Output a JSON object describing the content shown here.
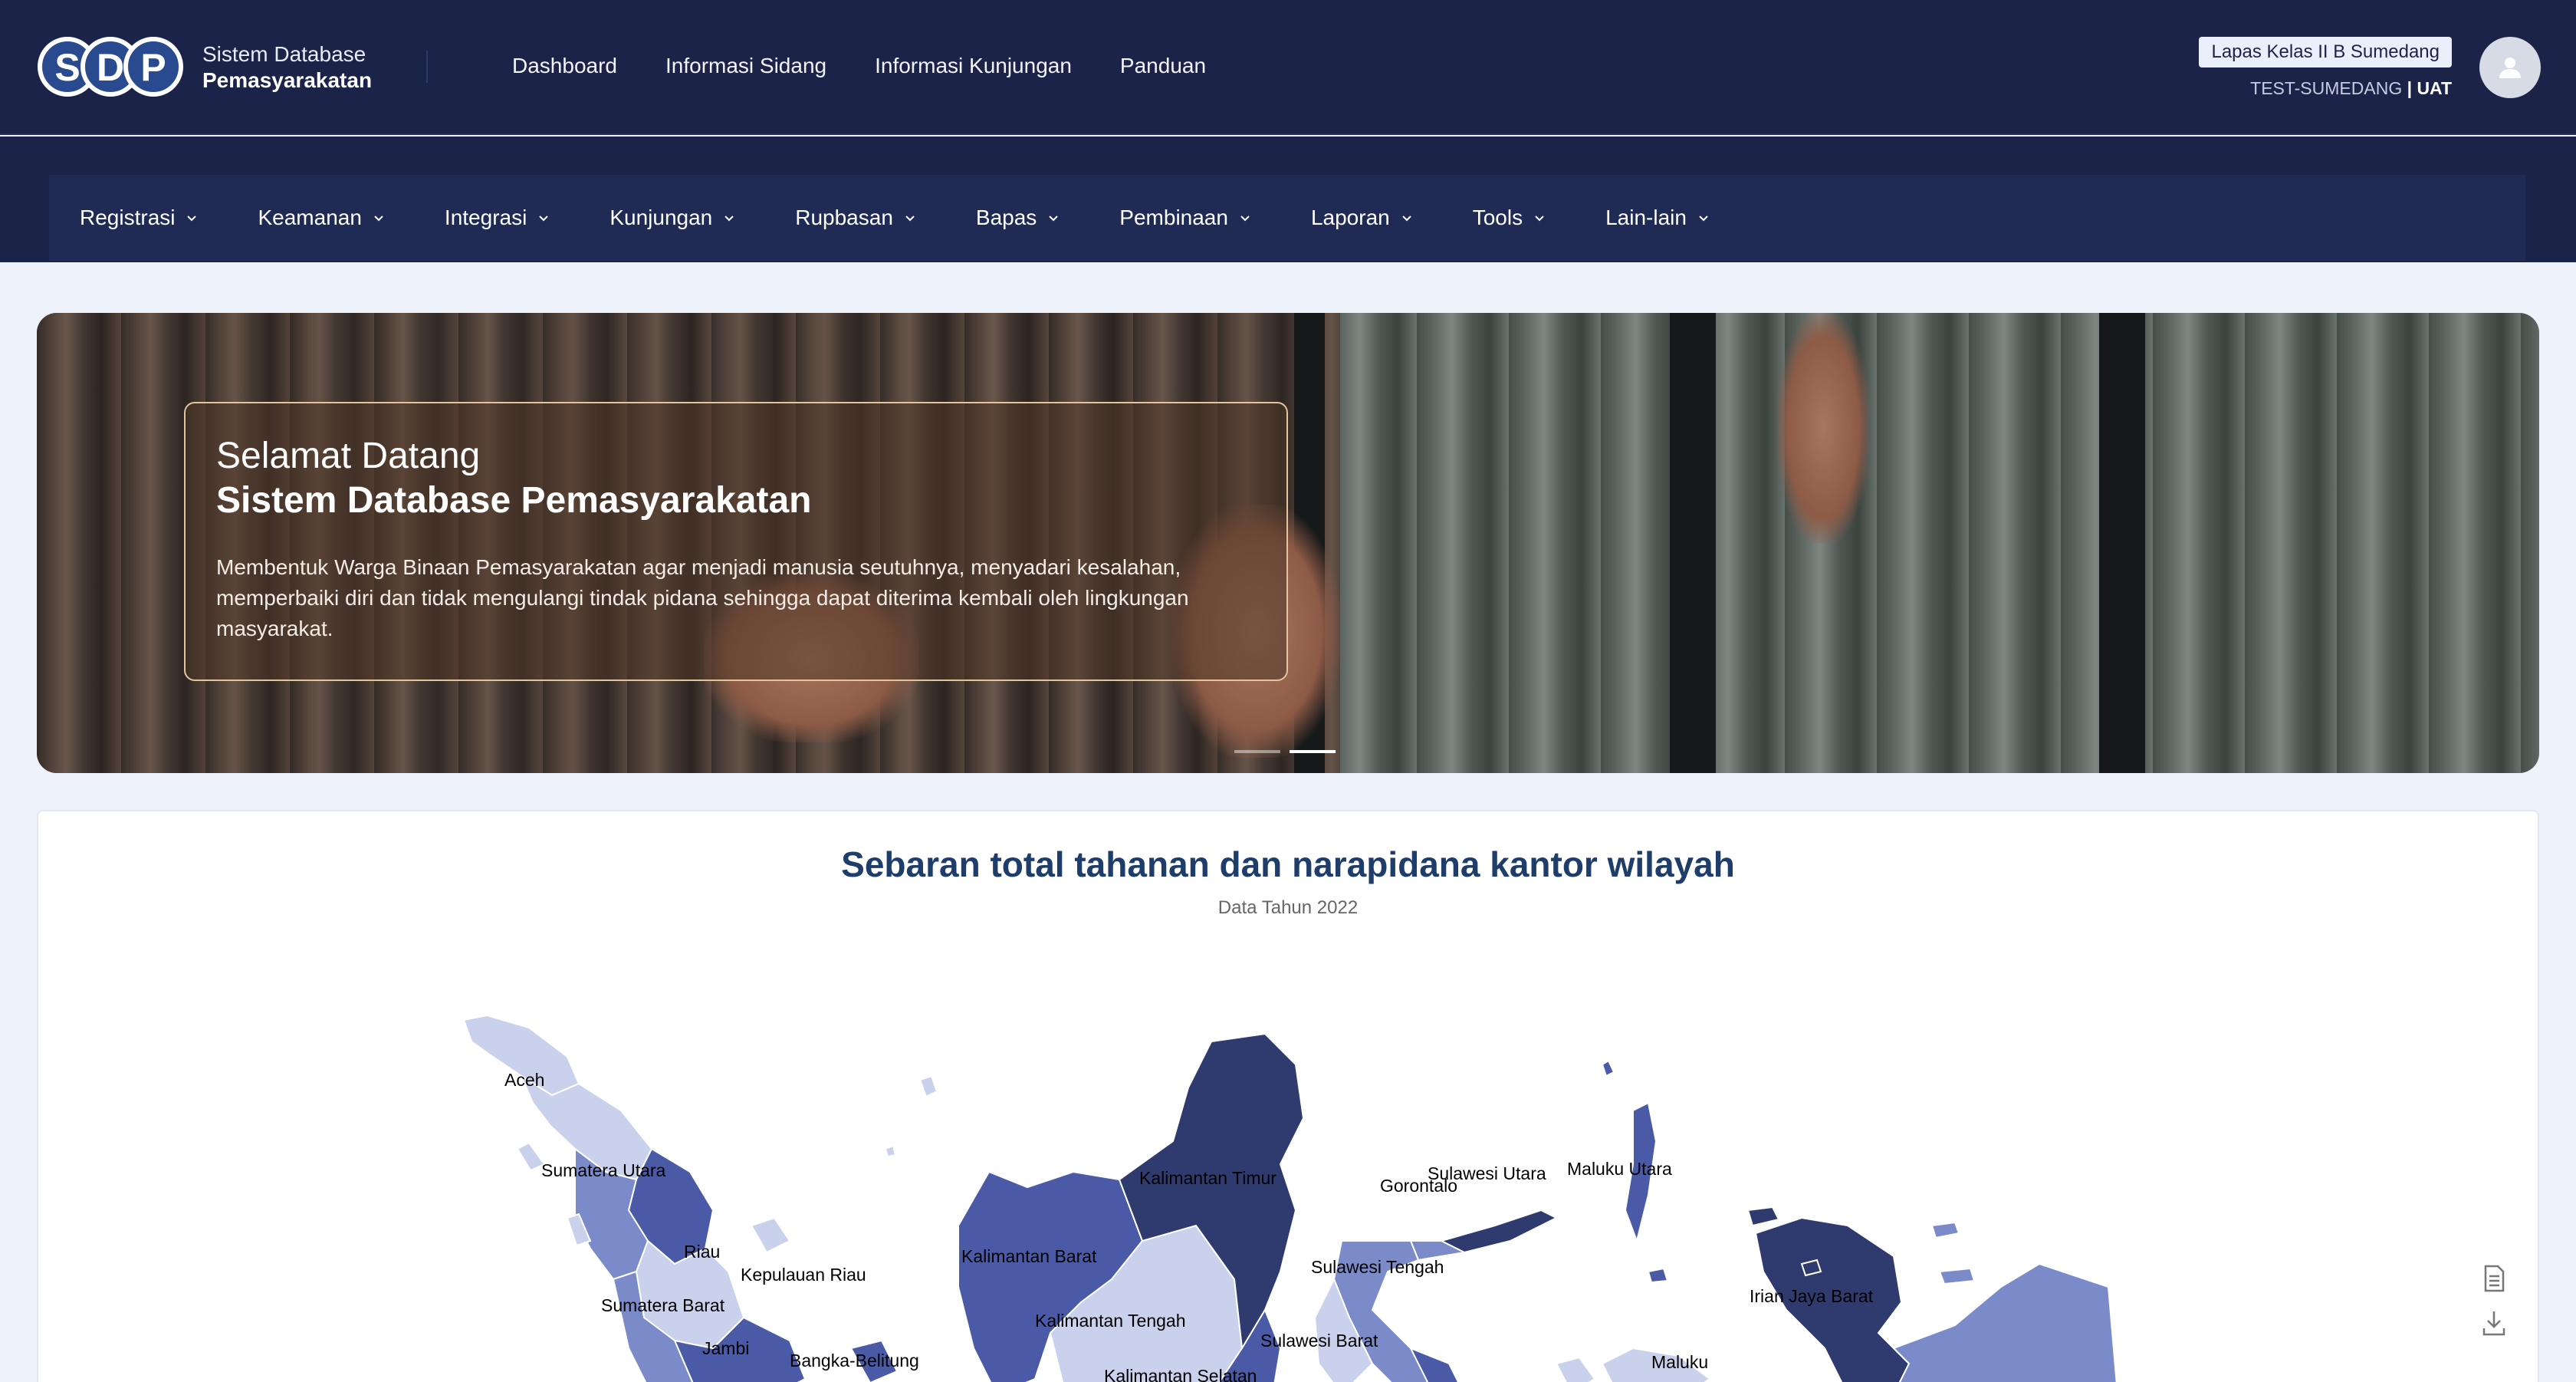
{
  "header": {
    "brand_line1": "Sistem Database",
    "brand_line2": "Pemasyarakatan",
    "nav": [
      "Dashboard",
      "Informasi Sidang",
      "Informasi Kunjungan",
      "Panduan"
    ],
    "unit": "Lapas Kelas II B Sumedang",
    "username": "TEST-SUMEDANG",
    "separator": "|",
    "environment": "UAT"
  },
  "menu": [
    "Registrasi",
    "Keamanan",
    "Integrasi",
    "Kunjungan",
    "Rupbasan",
    "Bapas",
    "Pembinaan",
    "Laporan",
    "Tools",
    "Lain-lain"
  ],
  "hero": {
    "greeting": "Selamat Datang",
    "title": "Sistem Database Pemasyarakatan",
    "description": "Membentuk Warga Binaan Pemasyarakatan agar menjadi manusia seutuhnya, menyadari kesalahan, memperbaiki diri dan tidak mengulangi tindak pidana sehingga dapat diterima kembali oleh lingkungan masyarakat.",
    "slides": 2,
    "active_slide": 2
  },
  "map": {
    "title": "Sebaran total tahanan dan narapidana kantor wilayah",
    "subtitle": "Data Tahun 2022",
    "region_labels": [
      "Aceh",
      "Sumatera Utara",
      "Riau",
      "Kepulauan Riau",
      "Sumatera Barat",
      "Jambi",
      "Bangka-Belitung",
      "Kalimantan Timur",
      "Kalimantan Barat",
      "Kalimantan Tengah",
      "Kalimantan Selatan",
      "Sulawesi Utara",
      "Gorontalo",
      "Sulawesi Tengah",
      "Sulawesi Barat",
      "Maluku Utara",
      "Maluku",
      "Irian Jaya Barat"
    ],
    "colors": {
      "light": "#c9d1ec",
      "mid": "#7b8ac9",
      "strong": "#4b5aa6",
      "dark": "#2f3a6e"
    }
  },
  "icons": {
    "avatar": "user-icon",
    "menu_chevron": "chevron-down-icon",
    "side": [
      "document-icon",
      "download-icon"
    ]
  }
}
